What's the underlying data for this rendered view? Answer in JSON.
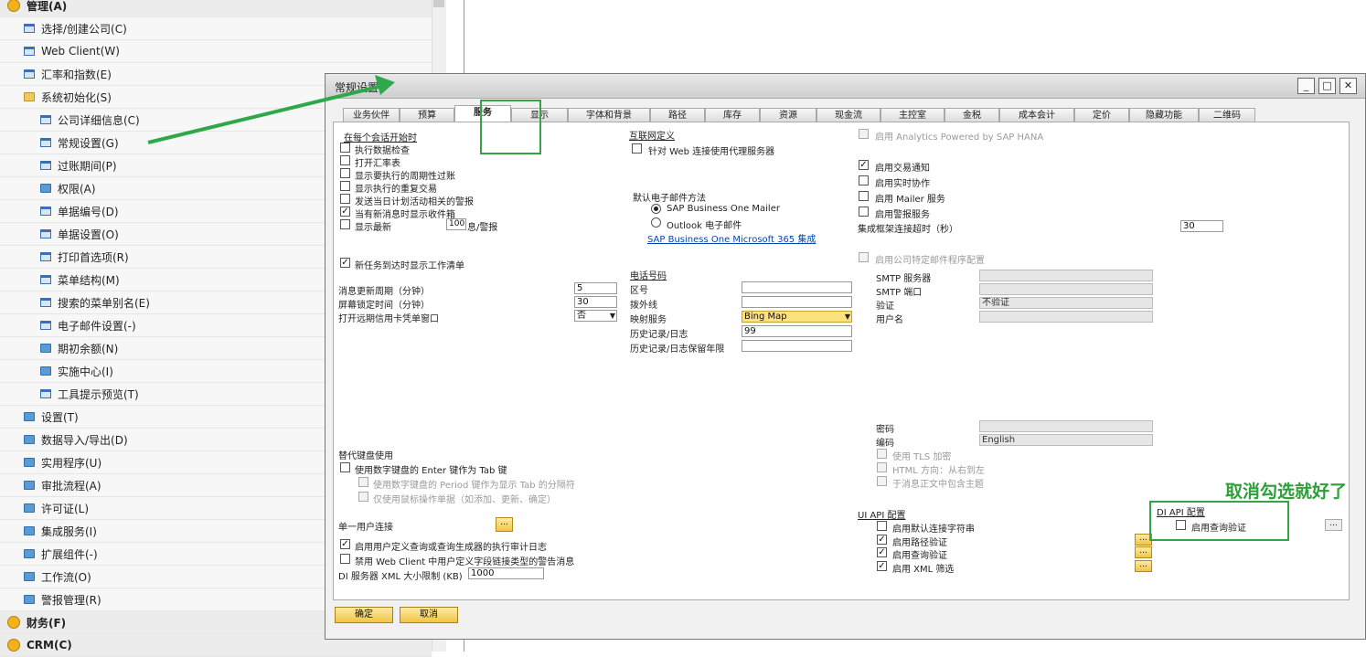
{
  "sidebar": {
    "items": [
      {
        "label": "管理(A)",
        "kind": "mod",
        "level": 0
      },
      {
        "label": "选择/创建公司(C)",
        "kind": "doc",
        "level": 1
      },
      {
        "label": "Web Client(W)",
        "kind": "doc",
        "level": 1
      },
      {
        "label": "汇率和指数(E)",
        "kind": "doc",
        "level": 1
      },
      {
        "label": "系统初始化(S)",
        "kind": "folderopen",
        "level": 1
      },
      {
        "label": "公司详细信息(C)",
        "kind": "doc",
        "level": 2
      },
      {
        "label": "常规设置(G)",
        "kind": "doc",
        "level": 2
      },
      {
        "label": "过账期间(P)",
        "kind": "doc",
        "level": 2
      },
      {
        "label": "权限(A)",
        "kind": "folder",
        "level": 2
      },
      {
        "label": "单据编号(D)",
        "kind": "doc",
        "level": 2
      },
      {
        "label": "单据设置(O)",
        "kind": "doc",
        "level": 2
      },
      {
        "label": "打印首选项(R)",
        "kind": "doc",
        "level": 2
      },
      {
        "label": "菜单结构(M)",
        "kind": "doc",
        "level": 2
      },
      {
        "label": "搜索的菜单别名(E)",
        "kind": "doc",
        "level": 2
      },
      {
        "label": "电子邮件设置(-)",
        "kind": "doc",
        "level": 2
      },
      {
        "label": "期初余额(N)",
        "kind": "folder",
        "level": 2
      },
      {
        "label": "实施中心(I)",
        "kind": "folder",
        "level": 2
      },
      {
        "label": "工具提示预览(T)",
        "kind": "doc",
        "level": 2
      },
      {
        "label": "设置(T)",
        "kind": "folder",
        "level": 1
      },
      {
        "label": "数据导入/导出(D)",
        "kind": "folder",
        "level": 1
      },
      {
        "label": "实用程序(U)",
        "kind": "folder",
        "level": 1
      },
      {
        "label": "审批流程(A)",
        "kind": "folder",
        "level": 1
      },
      {
        "label": "许可证(L)",
        "kind": "folder",
        "level": 1
      },
      {
        "label": "集成服务(I)",
        "kind": "folder",
        "level": 1
      },
      {
        "label": "扩展组件(-)",
        "kind": "folder",
        "level": 1
      },
      {
        "label": "工作流(O)",
        "kind": "folder",
        "level": 1
      },
      {
        "label": "警报管理(R)",
        "kind": "folder",
        "level": 1
      },
      {
        "label": "财务(F)",
        "kind": "mod",
        "level": 0
      },
      {
        "label": "CRM(C)",
        "kind": "mod",
        "level": 0
      }
    ]
  },
  "dialog": {
    "title": "常规设置",
    "win_min": "_",
    "win_max": "□",
    "win_close": "✕",
    "tabs": [
      "业务伙伴",
      "预算",
      "服务",
      "显示",
      "字体和背景",
      "路径",
      "库存",
      "资源",
      "现金流",
      "主控室",
      "金税",
      "成本会计",
      "定价",
      "隐藏功能",
      "二维码"
    ],
    "active_tab": "服务",
    "col1": {
      "session_header": "在每个会话开始时",
      "session_checks": [
        {
          "label": "执行数据检查",
          "checked": false
        },
        {
          "label": "打开汇率表",
          "checked": false
        },
        {
          "label": "显示要执行的周期性过账",
          "checked": false
        },
        {
          "label": "显示执行的重复交易",
          "checked": false
        },
        {
          "label": "发送当日计划活动相关的警报",
          "checked": false
        },
        {
          "label": "当有新消息时显示收件箱",
          "checked": true
        }
      ],
      "show_latest_label": "显示最新",
      "show_latest_value": "100",
      "show_latest_suffix": "息/警报",
      "worklist_label": "新任务到达时显示工作清单",
      "refresh_label": "消息更新周期（分钟）",
      "refresh_value": "5",
      "screenlock_label": "屏幕锁定时间（分钟）",
      "screenlock_value": "30",
      "overdue_label": "打开远期信用卡凭单窗口",
      "overdue_value": "否",
      "kbd_header": "替代键盘使用",
      "kbd_enter_label": "使用数字键盘的 Enter 键作为 Tab 键",
      "kbd_period_label": "使用数字键盘的 Period 键作为显示 Tab 的分隔符",
      "kbd_mouse_label": "仅使用鼠标操作单据（如添加、更新、确定）",
      "single_user_label": "单一用户连接",
      "ellipsis": "...",
      "udq_log_label": "启用用户定义查询或查询生成器的执行审计日志",
      "webclient_label": "禁用 Web Client 中用户定义字段链接类型的警告消息",
      "di_xml_label": "DI 服务器 XML 大小限制 (KB)",
      "di_xml_value": "1000"
    },
    "col2": {
      "internet_header": "互联网定义",
      "proxy_label": "针对 Web 连接使用代理服务器",
      "email_header": "默认电子邮件方法",
      "email_opt1": "SAP Business One Mailer",
      "email_opt2": "Outlook 电子邮件",
      "o365_link": "SAP Business One Microsoft 365 集成",
      "phone_header": "电话号码",
      "area_code_label": "区号",
      "ext_label": "拨外线",
      "map_label": "映射服务",
      "map_value": "Bing Map",
      "history_label": "历史记录/日志",
      "history_value": "99",
      "history_keep_label": "历史记录/日志保留年限"
    },
    "col3": {
      "hana_label": "启用 Analytics Powered by SAP HANA",
      "trans_notify_label": "启用交易通知",
      "realtime_label": "启用实时协作",
      "mailer_label": "启用 Mailer 服务",
      "alert_service_label": "启用警报服务",
      "timeout_label": "集成框架连接超时（秒）",
      "timeout_value": "30",
      "company_mail_label": "启用公司特定邮件程序配置",
      "smtp_server_label": "SMTP 服务器",
      "smtp_port_label": "SMTP 端口",
      "auth_label": "验证",
      "auth_value": "不验证",
      "username_label": "用户名",
      "password_label": "密码",
      "encoding_label": "编码",
      "encoding_value": "English",
      "tls_label": "使用 TLS 加密",
      "html_dir_label": "HTML 方向：从右到左",
      "subject_label": "于消息正文中包含主题",
      "uiapi_header": "UI API 配置",
      "uiapi_checks": [
        {
          "label": "启用默认连接字符串",
          "checked": false
        },
        {
          "label": "启用路径验证",
          "checked": true
        },
        {
          "label": "启用查询验证",
          "checked": true
        },
        {
          "label": "启用 XML 筛选",
          "checked": true
        }
      ],
      "diapi_header": "DI API 配置",
      "diapi_query_label": "启用查询验证"
    },
    "ok_label": "确定",
    "cancel_label": "取消"
  },
  "annotation": {
    "text": "取消勾选就好了",
    "color": "#2e9e3a"
  }
}
